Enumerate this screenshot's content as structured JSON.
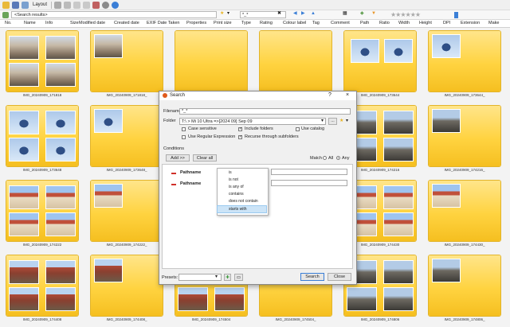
{
  "toolbar": {
    "layout_label": "Layout",
    "colors": {
      "accent": "#3b7fd6",
      "star": "#aaaaaa"
    }
  },
  "address": {
    "value": "<Search results>"
  },
  "filter": {
    "value": "*_*"
  },
  "columns": [
    "No.",
    "Name",
    "Info",
    "Size",
    "Modified date",
    "Created date",
    "EXIF Date Taken",
    "Properties",
    "Print size",
    "Type",
    "Rating",
    "Colour label",
    "Tag",
    "Comment",
    "Path",
    "Ratio",
    "Width",
    "Height",
    "DPI",
    "Extension",
    "Make"
  ],
  "thumbnails": [
    {
      "caption": "IMG_20240909_171818",
      "kind": "street",
      "count": 4
    },
    {
      "caption": "IMG_20240909_171818_",
      "kind": "street",
      "count": 1
    },
    {
      "caption": "",
      "kind": "none",
      "count": 0
    },
    {
      "caption": "",
      "kind": "none",
      "count": 0
    },
    {
      "caption": "IMG_20240909_173644",
      "kind": "church",
      "count": 2
    },
    {
      "caption": "IMG_20240909_173644_",
      "kind": "church",
      "count": 1
    },
    {
      "caption": "IMG_20240909_173648",
      "kind": "church",
      "count": 4
    },
    {
      "caption": "IMG_20240909_173648_",
      "kind": "church",
      "count": 1
    },
    {
      "caption": "",
      "kind": "none",
      "count": 0
    },
    {
      "caption": "",
      "kind": "none",
      "count": 0
    },
    {
      "caption": "IMG_20240909_174216",
      "kind": "bridge",
      "count": 4
    },
    {
      "caption": "IMG_20240909_174216_",
      "kind": "bridge",
      "count": 1
    },
    {
      "caption": "IMG_20240909_174222",
      "kind": "houses",
      "count": 4
    },
    {
      "caption": "IMG_20240909_174222_",
      "kind": "houses",
      "count": 1
    },
    {
      "caption": "",
      "kind": "none",
      "count": 0
    },
    {
      "caption": "",
      "kind": "none",
      "count": 0
    },
    {
      "caption": "IMG_20240909_174430",
      "kind": "houses",
      "count": 4
    },
    {
      "caption": "IMG_20240909_174430_",
      "kind": "houses",
      "count": 1
    },
    {
      "caption": "IMG_20240909_174408",
      "kind": "roof",
      "count": 4
    },
    {
      "caption": "IMG_20240909_174408_",
      "kind": "roof",
      "count": 1
    },
    {
      "caption": "IMG_20240909_174504",
      "kind": "roof",
      "count": 4
    },
    {
      "caption": "IMG_20240909_174504_",
      "kind": "roof",
      "count": 1
    },
    {
      "caption": "IMG_20240909_174806",
      "kind": "bridge",
      "count": 4
    },
    {
      "caption": "IMG_20240909_174806_",
      "kind": "bridge",
      "count": 1
    }
  ],
  "dialog": {
    "title": "Search",
    "help": "?",
    "close": "×",
    "filename_label": "Filename",
    "filename_value": "*_*",
    "folder_label": "Folder",
    "folder_value": "T:\\ > Mi 10 Ultra =>[2024 09] Sep 09",
    "browse": "...",
    "options": [
      {
        "label": "Case sensitive",
        "checked": false
      },
      {
        "label": "Include folders",
        "checked": true
      },
      {
        "label": "Use catalog",
        "checked": false
      },
      {
        "label": "Use Regular Expression",
        "checked": false
      },
      {
        "label": "Recurse through subfolders",
        "checked": true
      }
    ],
    "conditions_label": "Conditions",
    "add_button": "Add >>",
    "clear_button": "Clear all",
    "match_label": "Match",
    "match_all": "All",
    "match_any": "Any",
    "rows": [
      {
        "field": "Pathname"
      },
      {
        "field": "Pathname"
      }
    ],
    "presets_label": "Presets:",
    "search_button": "Search",
    "close_button": "Close"
  },
  "operator_menu": {
    "items": [
      "is",
      "is not",
      "is any of",
      "contains",
      "does not contain",
      "starts with"
    ],
    "selected": "starts with"
  }
}
